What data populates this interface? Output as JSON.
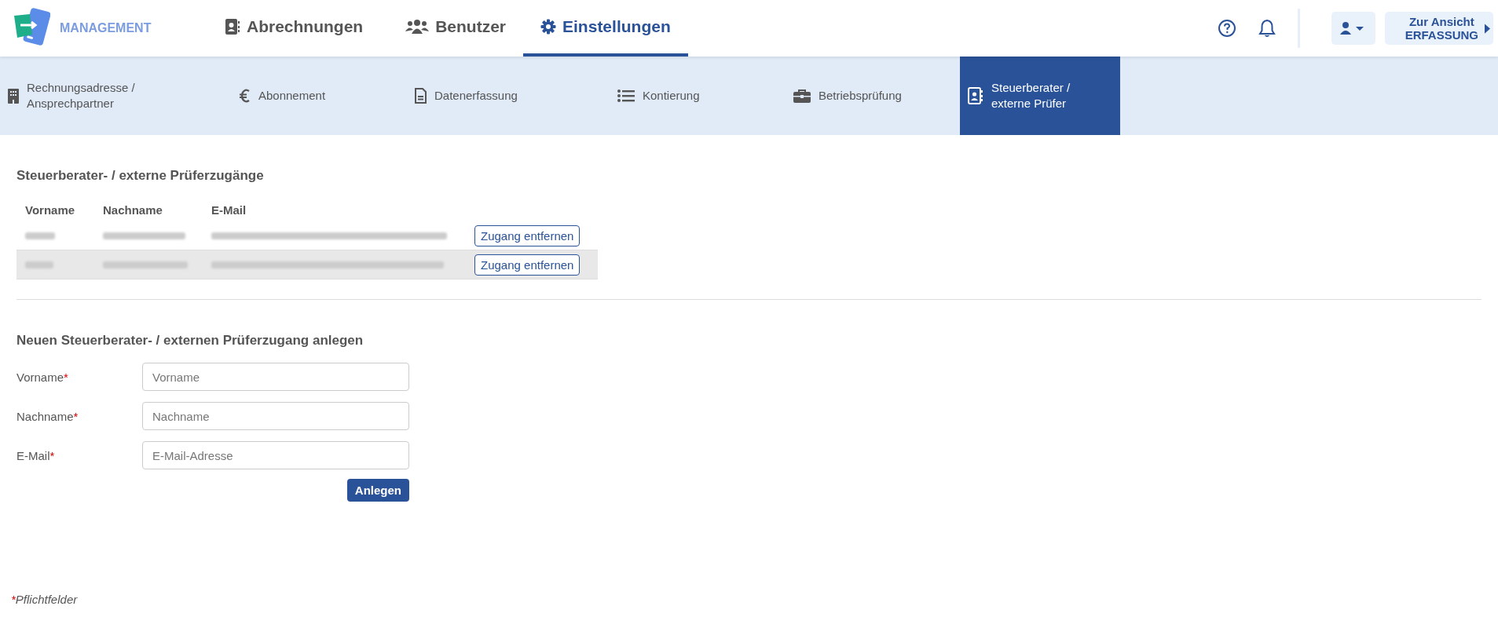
{
  "brand": {
    "name": "MANAGEMENT"
  },
  "main_nav": [
    {
      "label": "Abrechnungen",
      "kind": "contacts",
      "selected": false
    },
    {
      "label": "Benutzer",
      "kind": "users",
      "selected": false
    },
    {
      "label": "Einstellungen",
      "kind": "gear",
      "selected": true
    }
  ],
  "header_actions": {
    "switch_view": [
      "Zur Ansicht",
      "ERFASSUNG"
    ]
  },
  "sub_nav": [
    {
      "label": "Rechnungsadresse / Ansprechpartner",
      "kind": "building",
      "selected": false
    },
    {
      "label": "Abonnement",
      "kind": "euro",
      "selected": false
    },
    {
      "label": "Datenerfassung",
      "kind": "document",
      "selected": false
    },
    {
      "label": "Kontierung",
      "kind": "list",
      "selected": false
    },
    {
      "label": "Betriebsprüfung",
      "kind": "briefcase",
      "selected": false
    },
    {
      "label": "Steuerberater / externe Prüfer",
      "kind": "contacts",
      "selected": true
    }
  ],
  "accesses": {
    "title": "Steuerberater- / externe Prüferzugänge",
    "columns": [
      "Vorname",
      "Nachname",
      "E-Mail"
    ],
    "rows": [
      {
        "remove_button": "Zugang entfernen"
      },
      {
        "remove_button": "Zugang entfernen"
      }
    ]
  },
  "new_access": {
    "title": "Neuen Steuerberater- / externen Prüferzugang anlegen",
    "fields": [
      {
        "label": "Vorname",
        "required_mark": "*",
        "placeholder": "Vorname"
      },
      {
        "label": "Nachname",
        "required_mark": "*",
        "placeholder": "Nachname"
      },
      {
        "label": "E-Mail",
        "required_mark": "*",
        "placeholder": "E-Mail-Adresse"
      }
    ],
    "submit": "Anlegen"
  },
  "footnote": {
    "mark": "*",
    "text": "Pflichtfelder"
  }
}
